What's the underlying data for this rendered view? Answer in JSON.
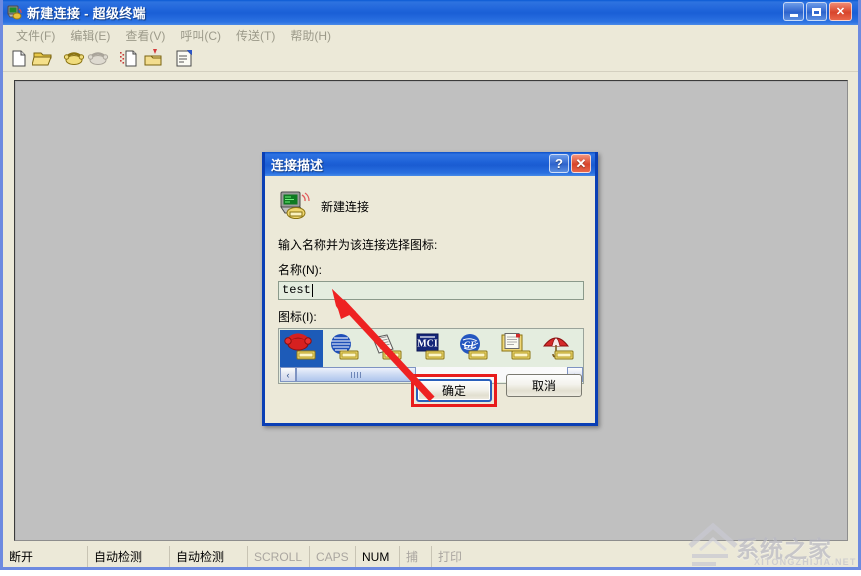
{
  "window": {
    "title": "新建连接 - 超级终端",
    "icon": "hyperterminal-icon",
    "buttons": {
      "minimize": "minimize-button",
      "maximize": "maximize-button",
      "close": "close-button"
    }
  },
  "menu": {
    "items": [
      {
        "label": "文件(F)"
      },
      {
        "label": "编辑(E)"
      },
      {
        "label": "查看(V)"
      },
      {
        "label": "呼叫(C)"
      },
      {
        "label": "传送(T)"
      },
      {
        "label": "帮助(H)"
      }
    ]
  },
  "toolbar": {
    "buttons": [
      {
        "name": "new-connection-icon"
      },
      {
        "name": "open-folder-icon"
      },
      {
        "name": "call-phone-icon"
      },
      {
        "name": "disconnect-phone-icon"
      },
      {
        "name": "send-file-icon"
      },
      {
        "name": "receive-file-icon"
      },
      {
        "name": "properties-icon"
      }
    ]
  },
  "status_bar": {
    "cells": [
      {
        "label": "断开",
        "dim": false
      },
      {
        "label": "自动检测",
        "dim": false
      },
      {
        "label": "自动检测",
        "dim": false
      },
      {
        "label": "SCROLL",
        "dim": true
      },
      {
        "label": "CAPS",
        "dim": true
      },
      {
        "label": "NUM",
        "dim": false
      },
      {
        "label": "捕",
        "dim": true
      },
      {
        "label": "打印",
        "dim": true
      }
    ]
  },
  "dialog": {
    "title": "连接描述",
    "help_button": "?",
    "close_button": "✕",
    "header_label": "新建连接",
    "header_icon": "computer-modem-icon",
    "instruction": "输入名称并为该连接选择图标:",
    "name_label": "名称(N):",
    "name_value": "test",
    "name_placeholder": "",
    "icon_label": "图标(I):",
    "icons": [
      {
        "name": "red-telephone-icon",
        "selected": true
      },
      {
        "name": "blue-globe-icon",
        "selected": false
      },
      {
        "name": "newspaper-icon",
        "selected": false
      },
      {
        "name": "mci-logo-icon",
        "selected": false
      },
      {
        "name": "ge-logo-icon",
        "selected": false
      },
      {
        "name": "notepad-document-icon",
        "selected": false
      },
      {
        "name": "red-umbrella-icon",
        "selected": false
      }
    ],
    "scroll": {
      "left_arrow": "‹",
      "right_arrow": "›"
    },
    "ok_label": "确定",
    "cancel_label": "取消",
    "highlight_color": "#e81c1c"
  },
  "annotation": {
    "arrow": "red-arrow",
    "arrow_color": "#ee2222"
  },
  "watermark": {
    "text": "系统之家",
    "subtext": "XITONGZHIJIA.NET"
  }
}
